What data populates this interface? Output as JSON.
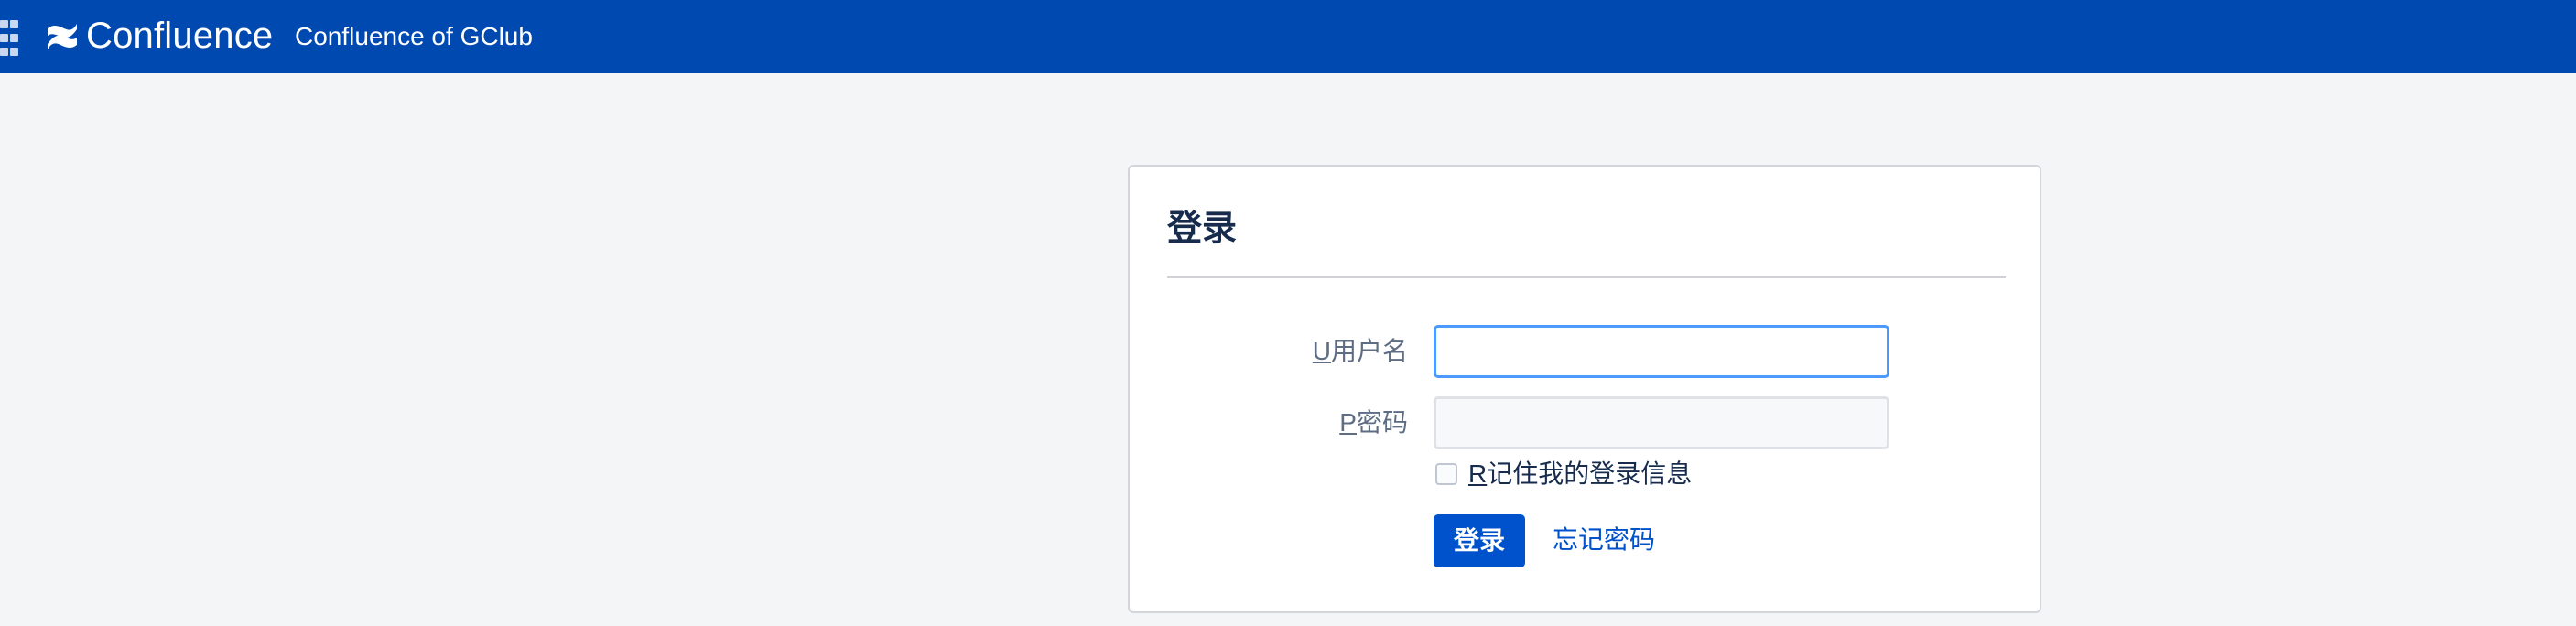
{
  "header": {
    "brand": "Confluence",
    "site_name": "Confluence of GClub",
    "brand_color": "#0049b0"
  },
  "login": {
    "title": "登录",
    "username": {
      "label_key": "U",
      "label_text": "用户名",
      "value": ""
    },
    "password": {
      "label_key": "P",
      "label_text": "密码",
      "value": ""
    },
    "remember": {
      "label_key": "R",
      "label_text": "记住我的登录信息",
      "checked": false
    },
    "submit_label": "登录",
    "forgot_label": "忘记密码",
    "accent_color": "#0052cc"
  },
  "icons": {
    "app_switcher": "app-grid-icon",
    "logo": "confluence-logo-icon"
  }
}
